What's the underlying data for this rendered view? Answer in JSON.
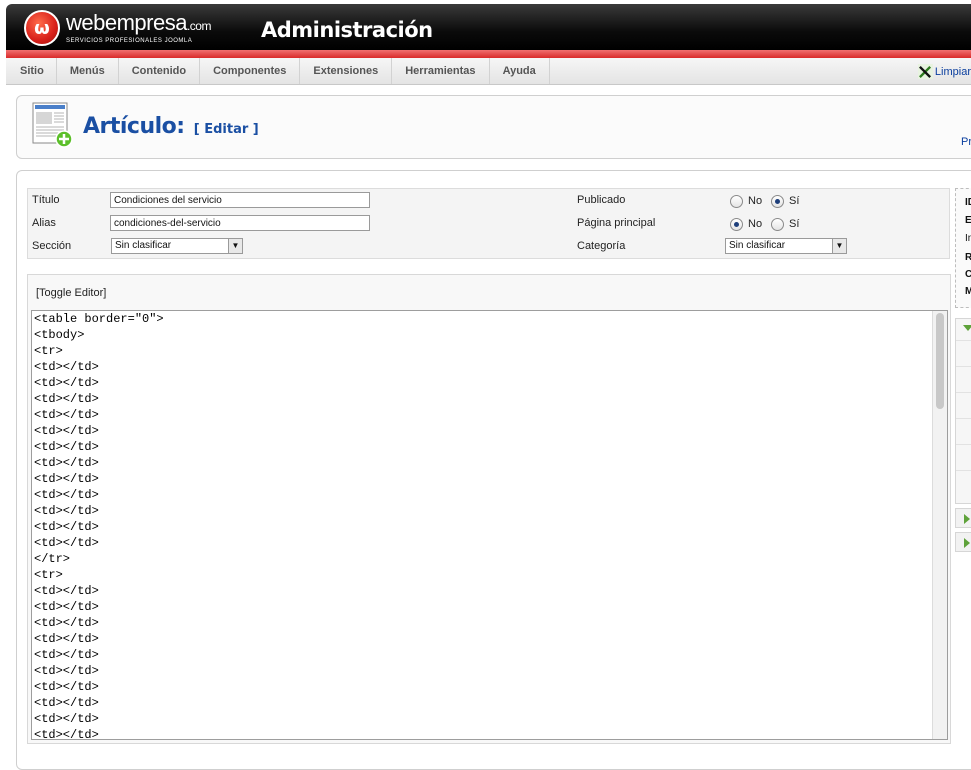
{
  "header": {
    "brand_name": "webempresa",
    "brand_tld": ".com",
    "brand_tagline": "SERVICIOS PROFESIONALES JOOMLA",
    "logo_glyph": "ω",
    "title": "Administración"
  },
  "menu": {
    "items": [
      "Sitio",
      "Menús",
      "Contenido",
      "Componentes",
      "Extensiones",
      "Herramientas",
      "Ayuda"
    ],
    "clear_label": "Limpiar"
  },
  "toolbar": {
    "title": "Artículo:",
    "subtitle": "[ Editar ]",
    "cut_label": "Pr"
  },
  "form": {
    "title_label": "Título",
    "title_value": "Condiciones del servicio",
    "alias_label": "Alias",
    "alias_value": "condiciones-del-servicio",
    "section_label": "Sección",
    "section_value": "Sin clasificar",
    "published_label": "Publicado",
    "frontpage_label": "Página principal",
    "category_label": "Categoría",
    "category_value": "Sin clasificar",
    "no_label": "No",
    "yes_label": "Sí",
    "published_selected": "Sí",
    "frontpage_selected": "No"
  },
  "editor": {
    "toggle_label": "[Toggle Editor]",
    "lines": [
      "<table border=\"0\">",
      "<tbody>",
      "<tr>",
      "<td></td>",
      "<td></td>",
      "<td></td>",
      "<td></td>",
      "<td></td>",
      "<td></td>",
      "<td></td>",
      "<td></td>",
      "<td></td>",
      "<td></td>",
      "<td></td>",
      "<td></td>",
      "</tr>",
      "<tr>",
      "<td></td>",
      "<td></td>",
      "<td></td>",
      "<td></td>",
      "<td></td>",
      "<td></td>",
      "<td></td>",
      "<td></td>",
      "<td></td>",
      "<td></td>"
    ]
  },
  "side": {
    "letters": [
      "ID",
      "E",
      "In",
      "R",
      "C",
      "M"
    ]
  },
  "colors": {
    "accent_blue": "#1a4fa3",
    "header_red": "#d92a2a",
    "header_black": "#000000"
  }
}
